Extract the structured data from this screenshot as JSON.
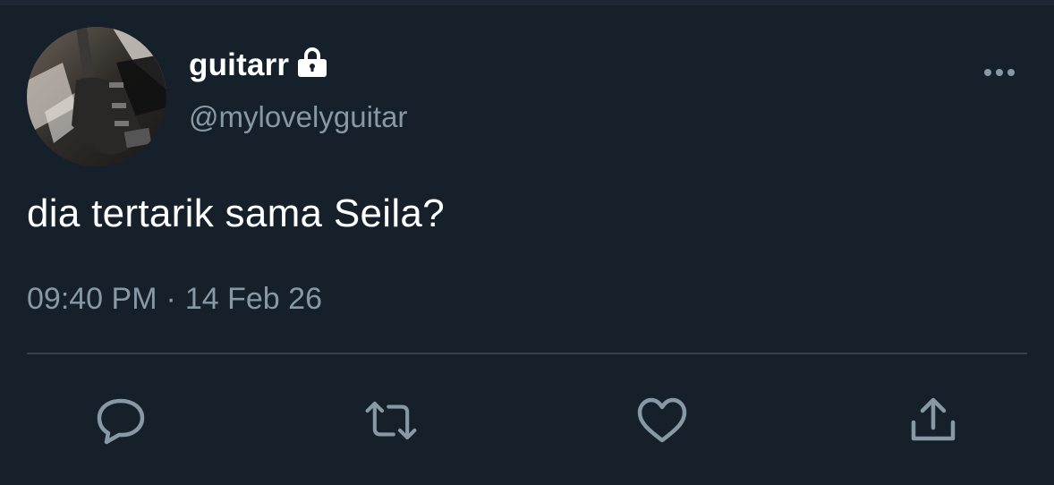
{
  "tweet": {
    "display_name": "guitarr",
    "handle": "@mylovelyguitar",
    "text": "dia tertarik sama Seila?",
    "time": "09:40 PM",
    "separator": "·",
    "date": "14 Feb 26",
    "protected_icon": "lock-icon",
    "avatar_icon": "guitar-photo"
  },
  "actions": [
    {
      "name": "reply",
      "icon": "comment-bubble-icon"
    },
    {
      "name": "retweet",
      "icon": "retweet-arrows-icon"
    },
    {
      "name": "like",
      "icon": "heart-icon"
    },
    {
      "name": "share",
      "icon": "share-upload-icon"
    }
  ],
  "colors": {
    "background": "#15202b",
    "text_primary": "#ffffff",
    "text_secondary": "#8899a6",
    "divider": "#38444d"
  }
}
